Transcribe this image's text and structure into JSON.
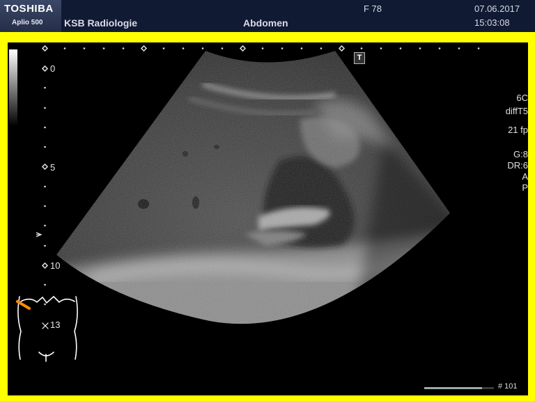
{
  "header": {
    "brand": "TOSHIBA",
    "model": "Aplio 500",
    "institution": "KSB Radiologie",
    "preset": "Abdomen",
    "patient": "F  78",
    "date": "07.06.2017",
    "time": "15:03:08"
  },
  "scale": {
    "depth_labels": [
      "0",
      "5",
      "10",
      "13"
    ]
  },
  "overlay": {
    "orientation_marker": "T",
    "params": [
      "6C",
      "diffT5",
      "21 fp",
      "G:8",
      "DR:6",
      "A",
      "P"
    ],
    "frame_counter": "# 101",
    "progress": 0.83
  },
  "colors": {
    "frame": "#ffff00",
    "header_bg": "#101a33",
    "probe_marker": "#ff8c00"
  },
  "icons": {
    "orientation": "t-orientation-icon",
    "body_mark": "torso-bodymark-icon",
    "focus": "focus-arrow-icon"
  }
}
